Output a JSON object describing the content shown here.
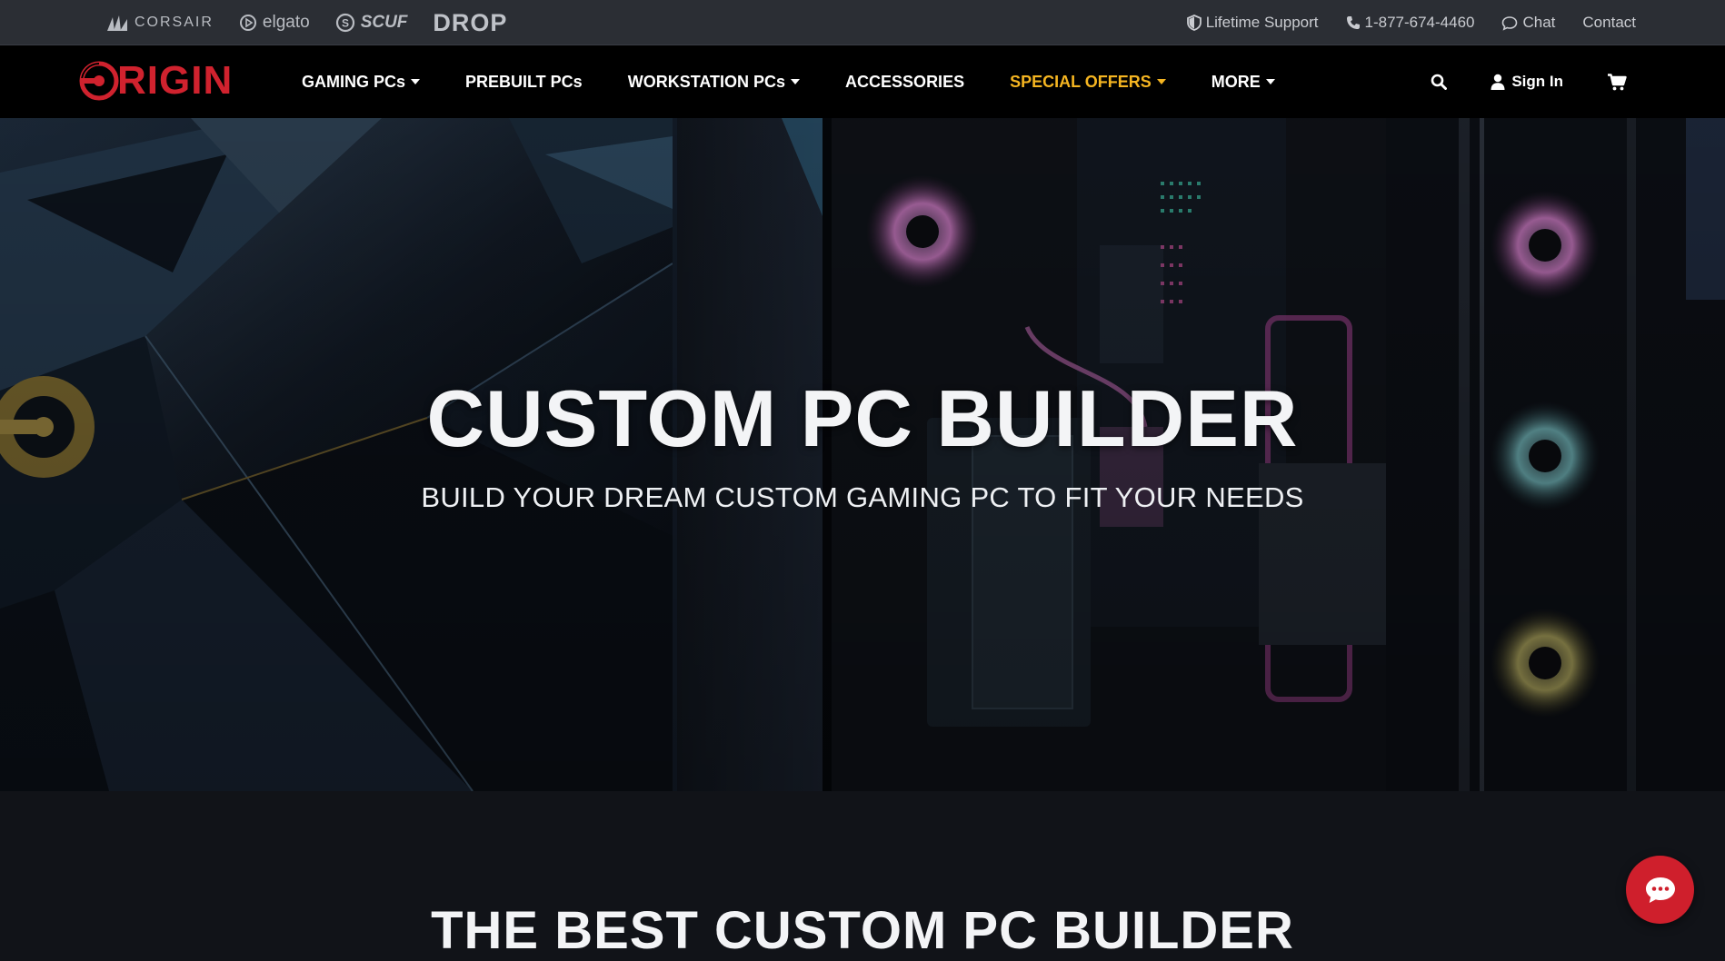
{
  "topbar": {
    "brands": [
      {
        "name": "CORSAIR",
        "icon": "corsair-sails-icon"
      },
      {
        "name": "elgato",
        "icon": "elgato-icon"
      },
      {
        "name": "SCUF",
        "icon": "scuf-icon"
      },
      {
        "name": "DROP",
        "icon": "drop-icon"
      }
    ],
    "support_label": "Lifetime Support",
    "phone": "1-877-674-4460",
    "chat_label": "Chat",
    "contact_label": "Contact"
  },
  "nav": {
    "logo_text": "RIGIN",
    "links": [
      {
        "label": "GAMING PCs",
        "dropdown": true
      },
      {
        "label": "PREBUILT PCs",
        "dropdown": false
      },
      {
        "label": "WORKSTATION PCs",
        "dropdown": true
      },
      {
        "label": "ACCESSORIES",
        "dropdown": false
      },
      {
        "label": "SPECIAL OFFERS",
        "dropdown": true
      },
      {
        "label": "MORE",
        "dropdown": true
      }
    ],
    "sign_in": "Sign In"
  },
  "hero": {
    "title": "CUSTOM PC BUILDER",
    "subtitle": "BUILD YOUR DREAM CUSTOM GAMING PC TO FIT YOUR NEEDS"
  },
  "section2": {
    "title": "THE BEST CUSTOM PC BUILDER"
  },
  "colors": {
    "brand_red": "#d0222e",
    "special_offers": "#f5b521",
    "topbar_bg": "#2b2e34",
    "nav_bg": "#000000",
    "page_bg": "#111318"
  }
}
